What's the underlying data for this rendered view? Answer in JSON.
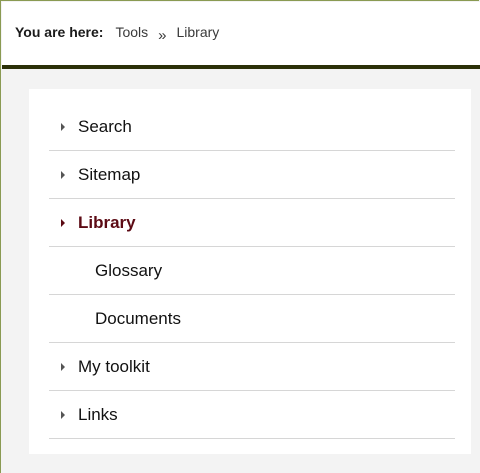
{
  "breadcrumb": {
    "prefix": "You are here:",
    "items": [
      "Tools",
      "Library"
    ],
    "separator": "»"
  },
  "menu": {
    "items": [
      {
        "label": "Search",
        "icon": "triangle-right-icon"
      },
      {
        "label": "Sitemap",
        "icon": "triangle-right-icon"
      },
      {
        "label": "Library",
        "icon": "triangle-right-icon",
        "active": true
      },
      {
        "label": "Glossary",
        "sub": true
      },
      {
        "label": "Documents",
        "sub": true
      },
      {
        "label": "My toolkit",
        "icon": "triangle-right-icon"
      },
      {
        "label": "Links",
        "icon": "triangle-right-icon"
      }
    ]
  },
  "colors": {
    "active": "#5c0a14",
    "header_border": "#2b3008",
    "frame_border": "#8a9a52",
    "background": "#f3f3f3"
  }
}
